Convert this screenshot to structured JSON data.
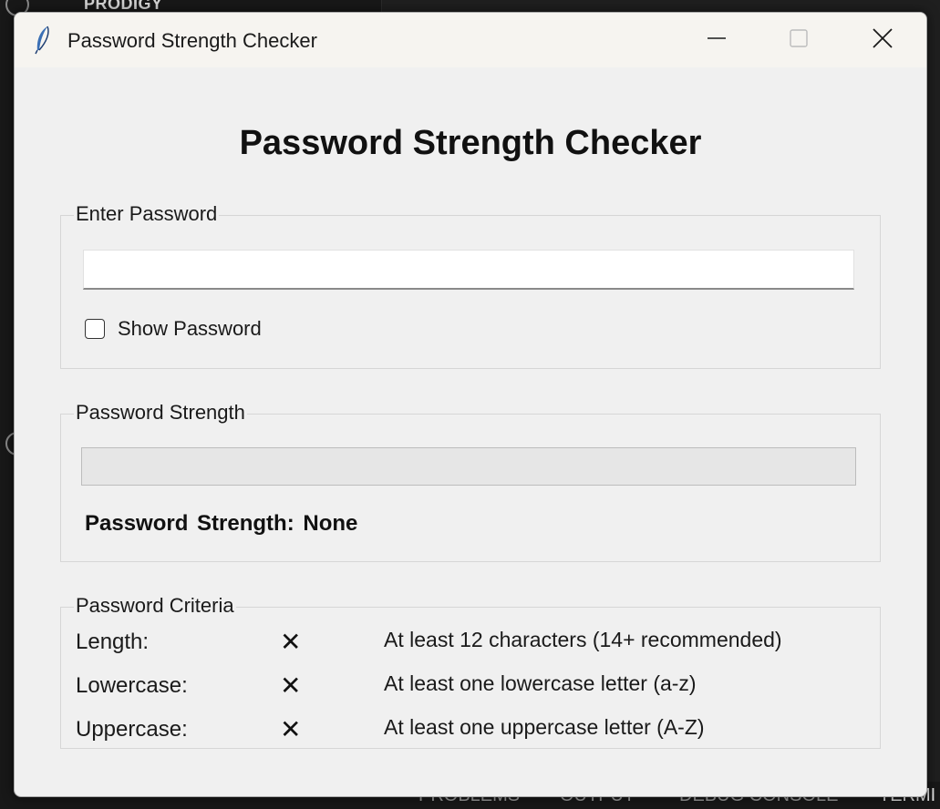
{
  "background": {
    "top_label": "PRODIGY",
    "bottom_tabs": [
      "PROBLEMS",
      "OUTPUT",
      "DEBUG CONSOLE",
      "TERMI"
    ]
  },
  "window": {
    "title": "Password Strength Checker",
    "icon": "feather-icon",
    "controls": {
      "minimize": "minimize-icon",
      "maximize": "maximize-icon",
      "close": "close-icon"
    }
  },
  "heading": "Password Strength Checker",
  "entry_group": {
    "label": "Enter Password",
    "password_value": "",
    "show_password_label": "Show Password",
    "show_password_checked": false
  },
  "strength_group": {
    "label": "Password Strength",
    "progress_fraction": 0,
    "strength_text": "Password Strength: None"
  },
  "criteria_group": {
    "label": "Password Criteria",
    "items": [
      {
        "name": "Length:",
        "mark": "✕",
        "description": "At least 12 characters (14+ recommended)"
      },
      {
        "name": "Lowercase:",
        "mark": "✕",
        "description": "At least one lowercase letter (a-z)"
      },
      {
        "name": "Uppercase:",
        "mark": "✕",
        "description": "At least one uppercase letter (A-Z)"
      }
    ]
  },
  "colors": {
    "window_bg": "#f0f0f0",
    "titlebar_bg": "#f6f4f0",
    "ide_bg": "#181818"
  }
}
